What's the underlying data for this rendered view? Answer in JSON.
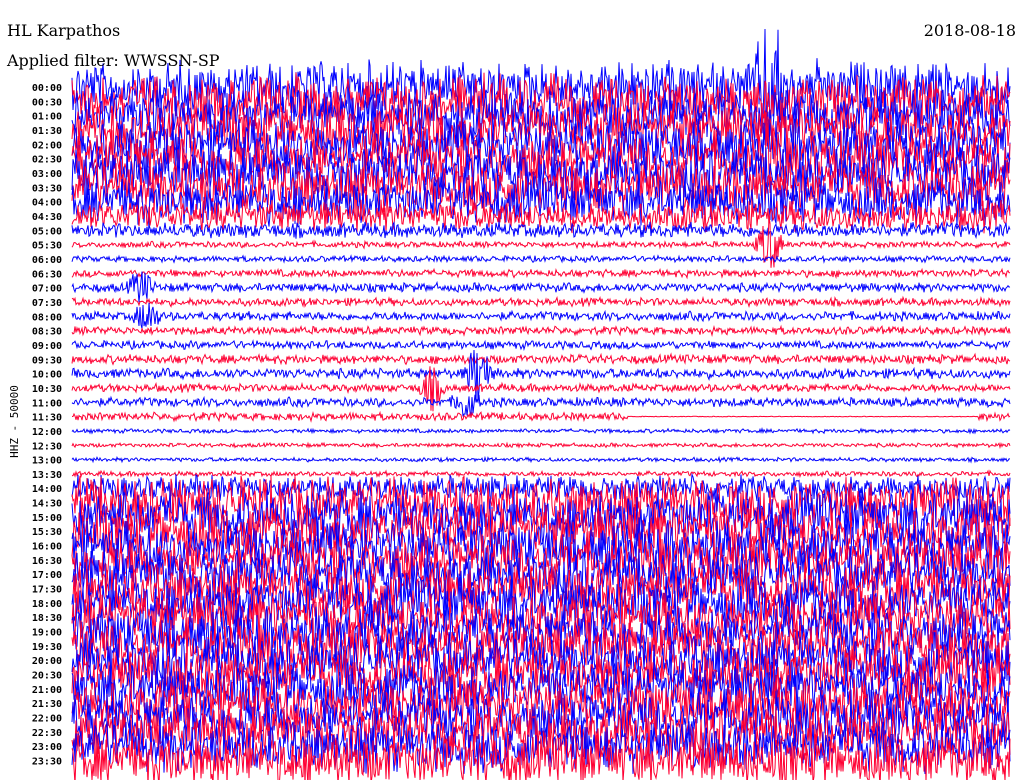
{
  "header": {
    "station": "HL Karpathos",
    "filter": "Applied filter: WWSSN-SP",
    "date": "2018-08-18"
  },
  "chart_data": {
    "type": "line",
    "title": "HL Karpathos",
    "subtitle": "Applied filter: WWSSN-SP",
    "ylabel": "HHZ - 50000",
    "minutes_per_line": 30,
    "colors": {
      "even": "#0000ff",
      "odd": "#ff0033"
    },
    "rows": [
      "00:00",
      "00:30",
      "01:00",
      "01:30",
      "02:00",
      "02:30",
      "03:00",
      "03:30",
      "04:00",
      "04:30",
      "05:00",
      "05:30",
      "06:00",
      "06:30",
      "07:00",
      "07:30",
      "08:00",
      "08:30",
      "09:00",
      "09:30",
      "10:00",
      "10:30",
      "11:00",
      "11:30",
      "12:00",
      "12:30",
      "13:00",
      "13:30",
      "14:00",
      "14:30",
      "15:00",
      "15:30",
      "16:00",
      "16:30",
      "17:00",
      "17:30",
      "18:00",
      "18:30",
      "19:00",
      "19:30",
      "20:00",
      "20:30",
      "21:00",
      "21:30",
      "22:00",
      "22:30",
      "23:00",
      "23:30"
    ],
    "relative_amplitude": [
      10,
      10,
      10,
      10,
      10,
      10,
      10,
      10,
      9,
      6,
      3,
      1.2,
      1.2,
      1.5,
      1.8,
      1.6,
      1.8,
      1.6,
      1.6,
      1.8,
      2,
      1.6,
      1.8,
      1.6,
      0.8,
      0.8,
      0.8,
      1,
      5,
      10,
      10,
      10,
      10,
      10,
      10,
      10,
      10,
      10,
      10,
      10,
      10,
      10,
      10,
      10,
      10,
      10,
      10,
      10
    ],
    "events": [
      {
        "row": 0,
        "minute": 22.3,
        "amplitude": 40
      },
      {
        "row": 5,
        "minute": 22.3,
        "amplitude": 12
      },
      {
        "row": 11,
        "minute": 22.3,
        "amplitude": 14
      },
      {
        "row": 14,
        "minute": 2.2,
        "amplitude": 8
      },
      {
        "row": 16,
        "minute": 2.4,
        "amplitude": 8
      },
      {
        "row": 20,
        "minute": 13.0,
        "amplitude": 16
      },
      {
        "row": 21,
        "minute": 11.5,
        "amplitude": 10
      },
      {
        "row": 22,
        "minute": 12.6,
        "amplitude": 8
      }
    ],
    "gaps": [
      {
        "row": 23,
        "from_minute": 17.8,
        "to_minute": 29.0
      }
    ]
  }
}
